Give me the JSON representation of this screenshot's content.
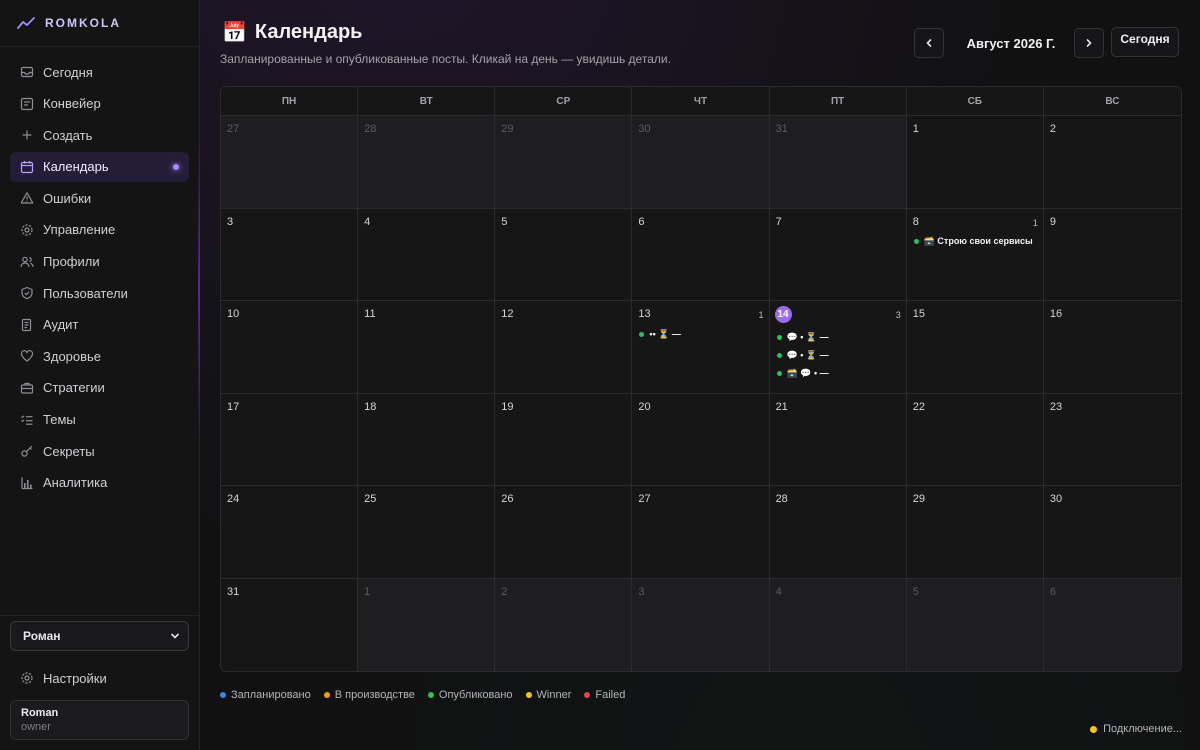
{
  "app": {
    "name": "ROMKOLA"
  },
  "colors": {
    "accent": "#a78bfa",
    "scheduled": "#3b82f6",
    "in_production": "#f59e0b",
    "published": "#22c55e",
    "winner": "#f5c518",
    "failed": "#ef4444"
  },
  "sidebar": {
    "items": [
      {
        "label": "Сегодня",
        "icon": "inbox-icon"
      },
      {
        "label": "Конвейер",
        "icon": "pipeline-icon"
      },
      {
        "label": "Создать",
        "icon": "plus-icon"
      },
      {
        "label": "Календарь",
        "icon": "calendar-icon",
        "active": true
      },
      {
        "label": "Ошибки",
        "icon": "warning-icon"
      },
      {
        "label": "Управление",
        "icon": "gear-icon"
      },
      {
        "label": "Профили",
        "icon": "users-icon"
      },
      {
        "label": "Пользователи",
        "icon": "shield-icon"
      },
      {
        "label": "Аудит",
        "icon": "scroll-icon"
      },
      {
        "label": "Здоровье",
        "icon": "heart-icon"
      },
      {
        "label": "Стратегии",
        "icon": "briefcase-icon"
      },
      {
        "label": "Темы",
        "icon": "list-check-icon"
      },
      {
        "label": "Секреты",
        "icon": "key-icon"
      },
      {
        "label": "Аналитика",
        "icon": "bar-chart-icon"
      }
    ],
    "profile_select": {
      "value": "Роман"
    },
    "settings_label": "Настройки",
    "user": {
      "name": "Roman",
      "role": "owner"
    }
  },
  "header": {
    "title": "Календарь",
    "title_emoji": "📅",
    "subtitle": "Запланированные и опубликованные посты. Кликай на день — увидишь детали.",
    "month": "Август 2026 Г.",
    "today_label": "Сегодня",
    "prev_icon": "‹",
    "next_icon": "›"
  },
  "calendar": {
    "weekdays": [
      "ПН",
      "ВТ",
      "СР",
      "ЧТ",
      "ПТ",
      "СБ",
      "ВС"
    ],
    "weeks": [
      [
        {
          "day": "27",
          "outside": true
        },
        {
          "day": "28",
          "outside": true
        },
        {
          "day": "29",
          "outside": true
        },
        {
          "day": "30",
          "outside": true
        },
        {
          "day": "31",
          "outside": true
        },
        {
          "day": "1"
        },
        {
          "day": "2"
        }
      ],
      [
        {
          "day": "3"
        },
        {
          "day": "4"
        },
        {
          "day": "5"
        },
        {
          "day": "6"
        },
        {
          "day": "7"
        },
        {
          "day": "8",
          "count": "1",
          "posts": [
            {
              "status": "published",
              "text": "🗃️ Строю свои сервисы"
            }
          ]
        },
        {
          "day": "9"
        }
      ],
      [
        {
          "day": "10"
        },
        {
          "day": "11"
        },
        {
          "day": "12"
        },
        {
          "day": "13",
          "count": "1",
          "posts": [
            {
              "status": "published",
              "text": "•• ⏳ —"
            }
          ]
        },
        {
          "day": "14",
          "today": true,
          "count": "3",
          "posts": [
            {
              "status": "published",
              "text": "💬 • ⏳ —"
            },
            {
              "status": "published",
              "text": "💬 • ⏳ —"
            },
            {
              "status": "published",
              "text": "🗃️ 💬 • —"
            }
          ]
        },
        {
          "day": "15"
        },
        {
          "day": "16"
        }
      ],
      [
        {
          "day": "17"
        },
        {
          "day": "18"
        },
        {
          "day": "19"
        },
        {
          "day": "20"
        },
        {
          "day": "21"
        },
        {
          "day": "22"
        },
        {
          "day": "23"
        }
      ],
      [
        {
          "day": "24"
        },
        {
          "day": "25"
        },
        {
          "day": "26"
        },
        {
          "day": "27"
        },
        {
          "day": "28"
        },
        {
          "day": "29"
        },
        {
          "day": "30"
        }
      ],
      [
        {
          "day": "31"
        },
        {
          "day": "1",
          "outside": true
        },
        {
          "day": "2",
          "outside": true
        },
        {
          "day": "3",
          "outside": true
        },
        {
          "day": "4",
          "outside": true
        },
        {
          "day": "5",
          "outside": true
        },
        {
          "day": "6",
          "outside": true
        }
      ]
    ]
  },
  "legend": [
    {
      "label": "Запланировано",
      "status": "scheduled"
    },
    {
      "label": "В производстве",
      "status": "in_production"
    },
    {
      "label": "Опубликовано",
      "status": "published"
    },
    {
      "label": "Winner",
      "status": "winner"
    },
    {
      "label": "Failed",
      "status": "failed"
    }
  ],
  "connection": {
    "label": "Подключение..."
  }
}
